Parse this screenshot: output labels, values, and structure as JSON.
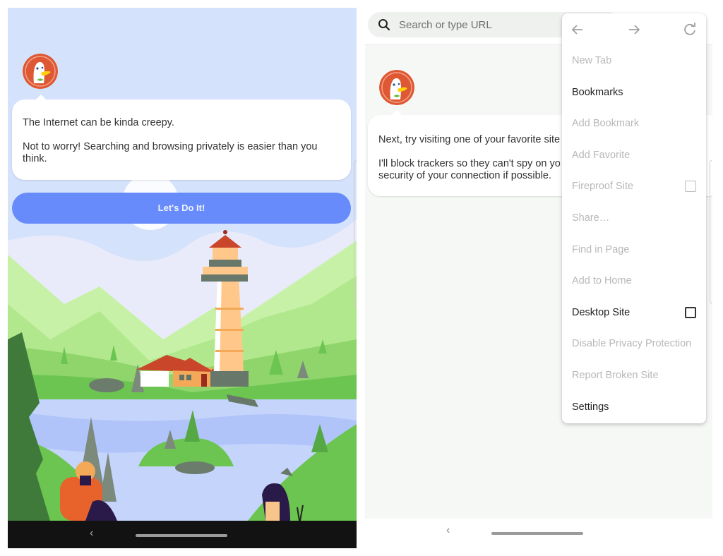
{
  "left_screen": {
    "message": {
      "line1": "The Internet can be kinda creepy.",
      "line2": "Not to worry! Searching and browsing privately is easier than you think."
    },
    "cta_button": "Let's Do It!",
    "illustration": "lighthouse-landscape",
    "nav": {
      "back_glyph": "‹"
    }
  },
  "right_screen": {
    "search": {
      "placeholder": "Search or type URL",
      "value": ""
    },
    "message": {
      "line1": "Next, try visiting one of your favorite site",
      "line2": "I'll block trackers so they can't spy on yo",
      "line3": "security of your connection if possible."
    },
    "nav": {
      "back_glyph": "‹"
    }
  },
  "menu": {
    "nav_icons": [
      "back-arrow",
      "forward-arrow",
      "refresh"
    ],
    "items": [
      {
        "label": "New Tab",
        "enabled": false
      },
      {
        "label": "Bookmarks",
        "enabled": true
      },
      {
        "label": "Add Bookmark",
        "enabled": false
      },
      {
        "label": "Add Favorite",
        "enabled": false
      },
      {
        "label": "Fireproof Site",
        "enabled": false,
        "checkbox": false
      },
      {
        "label": "Share…",
        "enabled": false
      },
      {
        "label": "Find in Page",
        "enabled": false
      },
      {
        "label": "Add to Home",
        "enabled": false
      },
      {
        "label": "Desktop Site",
        "enabled": true,
        "checkbox": false
      },
      {
        "label": "Disable Privacy Protection",
        "enabled": false
      },
      {
        "label": "Report Broken Site",
        "enabled": false
      },
      {
        "label": "Settings",
        "enabled": true
      }
    ]
  },
  "colors": {
    "cta": "#678bfb",
    "sky": "#d5e2fc",
    "duck_orange": "#de5833",
    "disabled_text": "#b8b8b8"
  }
}
